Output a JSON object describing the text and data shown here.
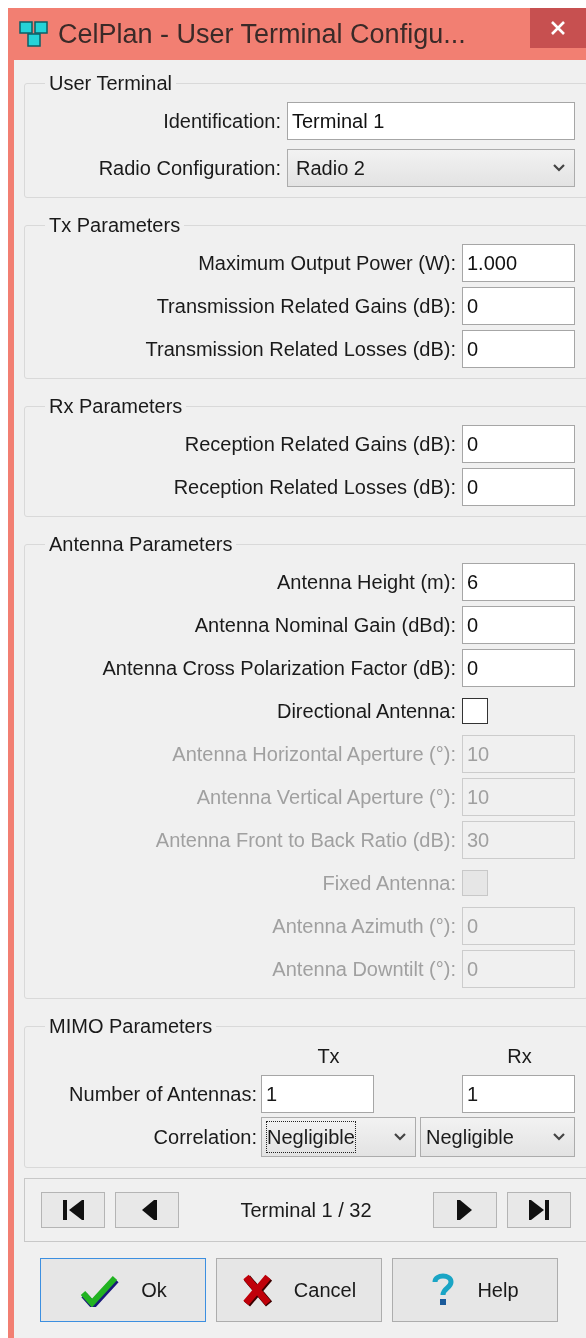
{
  "window": {
    "title": "CelPlan - User Terminal Configu..."
  },
  "sections": [
    {
      "title": "User Terminal",
      "wide": true,
      "rows": [
        {
          "kind": "text",
          "label": "Identification:",
          "value": "Terminal 1",
          "disabled": false
        },
        {
          "kind": "select",
          "label": "Radio Configuration:",
          "value": "Radio 2",
          "disabled": false
        }
      ]
    },
    {
      "title": "Tx Parameters",
      "wide": false,
      "rows": [
        {
          "kind": "text",
          "label": "Maximum Output Power (W):",
          "value": "1.000",
          "disabled": false
        },
        {
          "kind": "text",
          "label": "Transmission Related Gains (dB):",
          "value": "0",
          "disabled": false
        },
        {
          "kind": "text",
          "label": "Transmission Related Losses (dB):",
          "value": "0",
          "disabled": false
        }
      ]
    },
    {
      "title": "Rx Parameters",
      "wide": false,
      "rows": [
        {
          "kind": "text",
          "label": "Reception Related Gains (dB):",
          "value": "0",
          "disabled": false
        },
        {
          "kind": "text",
          "label": "Reception Related Losses (dB):",
          "value": "0",
          "disabled": false
        }
      ]
    },
    {
      "title": "Antenna Parameters",
      "wide": false,
      "rows": [
        {
          "kind": "text",
          "label": "Antenna Height (m):",
          "value": "6",
          "disabled": false
        },
        {
          "kind": "text",
          "label": "Antenna Nominal Gain (dBd):",
          "value": "0",
          "disabled": false
        },
        {
          "kind": "text",
          "label": "Antenna Cross Polarization Factor (dB):",
          "value": "0",
          "disabled": false
        },
        {
          "kind": "checkbox",
          "label": "Directional Antenna:",
          "checked": false,
          "disabled": false
        },
        {
          "kind": "text",
          "label": "Antenna Horizontal Aperture (°):",
          "value": "10",
          "disabled": true
        },
        {
          "kind": "text",
          "label": "Antenna Vertical Aperture (°):",
          "value": "10",
          "disabled": true
        },
        {
          "kind": "text",
          "label": "Antenna Front to Back Ratio (dB):",
          "value": "30",
          "disabled": true
        },
        {
          "kind": "checkbox",
          "label": "Fixed Antenna:",
          "checked": false,
          "disabled": true
        },
        {
          "kind": "text",
          "label": "Antenna Azimuth (°):",
          "value": "0",
          "disabled": true
        },
        {
          "kind": "text",
          "label": "Antenna Downtilt (°):",
          "value": "0",
          "disabled": true
        }
      ]
    }
  ],
  "mimo": {
    "title": "MIMO Parameters",
    "columns": [
      "Tx",
      "Rx"
    ],
    "antennas": {
      "label": "Number of Antennas:",
      "values": [
        "1",
        "1"
      ]
    },
    "correlation": {
      "label": "Correlation:",
      "selects": [
        {
          "value": "Negligible",
          "focused": true
        },
        {
          "value": "Negligible",
          "focused": false
        }
      ]
    }
  },
  "navigator": {
    "text": "Terminal 1 / 32"
  },
  "buttons": [
    {
      "kind": "ok",
      "label": "Ok",
      "default": true
    },
    {
      "kind": "cancel",
      "label": "Cancel",
      "default": false
    },
    {
      "kind": "help",
      "label": "Help",
      "default": false
    }
  ]
}
